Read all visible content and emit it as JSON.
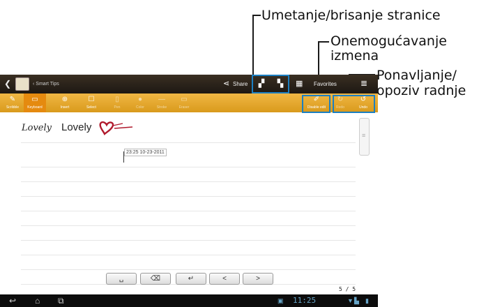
{
  "callouts": {
    "insert_delete_page": "Umetanje/brisanje stranice",
    "disable_edit_line1": "Onemogućavanje",
    "disable_edit_line2": "izmena",
    "undo_redo_line1": "Ponavljanje/",
    "undo_redo_line2": "opoziv radnje"
  },
  "titlebar": {
    "notebook_title": "Smart Tips",
    "share_label": "Share",
    "favorites_label": "Favorites"
  },
  "toolbar": {
    "scribble": "Scribble",
    "keyboard": "Keyboard",
    "insert": "Insert",
    "select": "Select",
    "pen": "Pen",
    "color": "Color",
    "stroke": "Stroke",
    "eraser": "Eraser",
    "disable_edit": "Disable edit",
    "redo": "Redo",
    "undo": "Undo"
  },
  "page": {
    "handwritten_word": "Lovely",
    "typed_word": "Lovely",
    "timestamp": "23:25 10-23-2011",
    "page_count": "5 / 5"
  },
  "keyboard": {
    "space": "␣",
    "backspace": "⌫",
    "enter": "↵",
    "left": "<",
    "right": ">"
  },
  "navbar": {
    "clock": "11:25"
  },
  "colors": {
    "toolbar_orange": "#e8a72e",
    "highlight_blue": "#1b7fc2",
    "heart_red": "#b0192c"
  }
}
